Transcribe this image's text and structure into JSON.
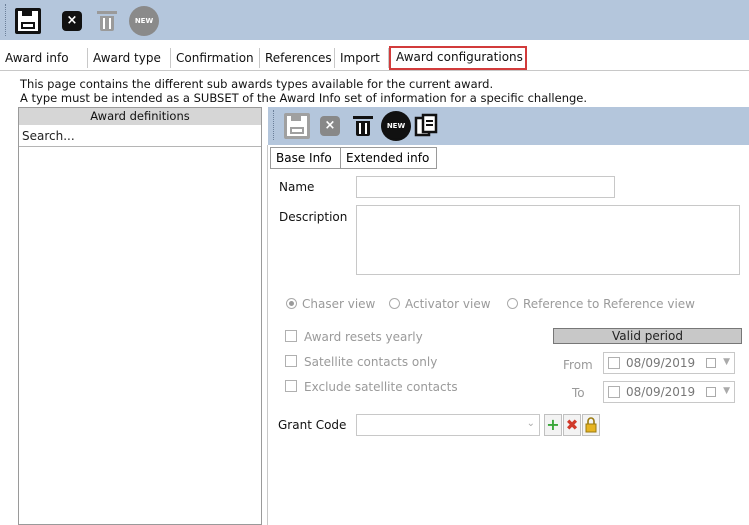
{
  "tabs": [
    "Award info",
    "Award type",
    "Confirmation",
    "References",
    "Import",
    "Award configurations"
  ],
  "active_tab": "Award configurations",
  "info_lines": [
    "This page contains the different sub awards types available for the current award.",
    "A type must be intended as a SUBSET of the Award Info set of information for a specific challenge."
  ],
  "left_panel": {
    "header": "Award definitions",
    "search_value": "Search..."
  },
  "icons": {
    "top_toolbar": [
      "save-icon",
      "close-icon",
      "trash-icon",
      "new-seal-icon"
    ],
    "right_toolbar": [
      "save-icon",
      "close-icon",
      "trash-icon",
      "new-seal-icon",
      "copy-icon"
    ],
    "new_seal_text": "NEW"
  },
  "subtabs": [
    "Base Info",
    "Extended info"
  ],
  "form": {
    "name_label": "Name",
    "description_label": "Description",
    "views": [
      "Chaser view",
      "Activator view",
      "Reference to Reference view"
    ],
    "selected_view": "Chaser view",
    "checkboxes": [
      "Award resets yearly",
      "Satellite contacts only",
      "Exclude satellite contacts"
    ],
    "valid_period_header": "Valid period",
    "from_label": "From",
    "to_label": "To",
    "from_date": "08/09/2019",
    "to_date": "08/09/2019",
    "grant_code_label": "Grant Code"
  },
  "colors": {
    "toolbar_bg": "#b4c6dc",
    "active_tab_border": "#d23b3b",
    "add_green": "#3aa63a",
    "delete_red": "#d03a2a",
    "lock_yellow": "#e6b422"
  }
}
